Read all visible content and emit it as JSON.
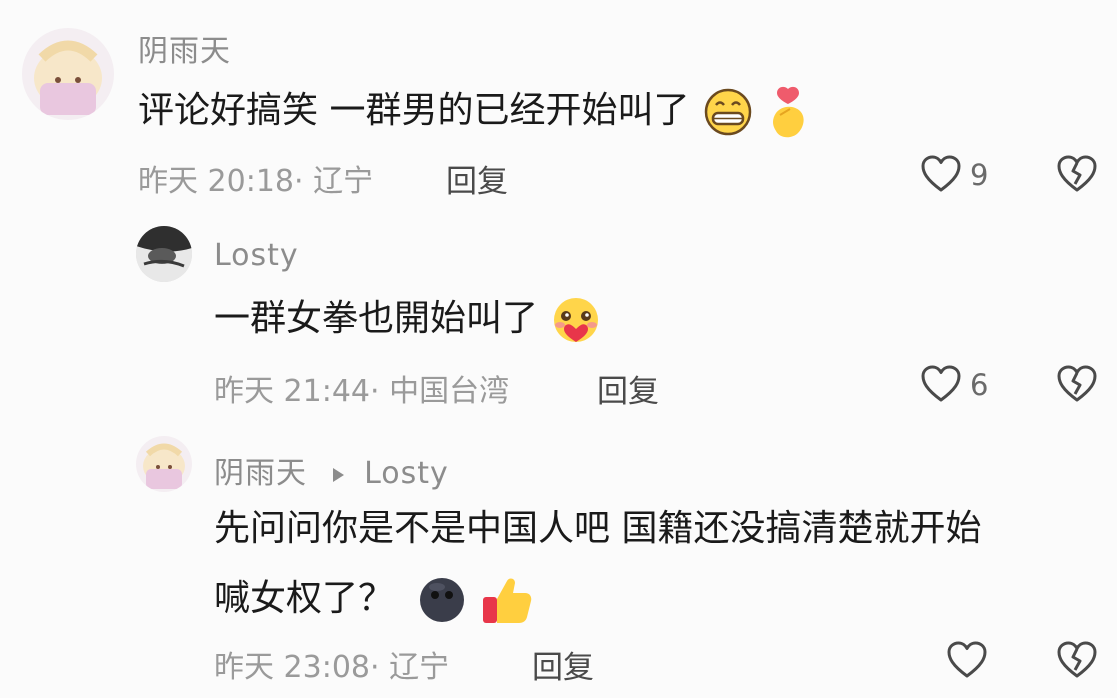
{
  "comments": [
    {
      "author": "阴雨天",
      "text": "评论好搞笑 一群男的已经开始叫了",
      "emojis": [
        "grin-emoji",
        "finger-heart-emoji"
      ],
      "time": "昨天 20:18",
      "location": "· 辽宁",
      "reply_label": "回复",
      "likes": "9"
    },
    {
      "author": "Losty",
      "text": "一群女拳也開始叫了",
      "emojis": [
        "blush-heart-emoji"
      ],
      "time": "昨天 21:44",
      "location": "· 中国台湾",
      "reply_label": "回复",
      "likes": "6"
    },
    {
      "author": "阴雨天",
      "reply_to": "Losty",
      "text_line1": "先问问你是不是中国人吧 国籍还没搞清楚就开始",
      "text_line2": "喊女权了？",
      "emojis": [
        "dark-face-emoji",
        "thumbs-up-emoji"
      ],
      "time": "昨天 23:08",
      "location": "· 辽宁",
      "reply_label": "回复",
      "likes": ""
    }
  ],
  "colors": {
    "background": "#fbfbfb",
    "name": "#8c8c8c",
    "meta": "#9a9a9a",
    "text": "#1a1a1a"
  }
}
